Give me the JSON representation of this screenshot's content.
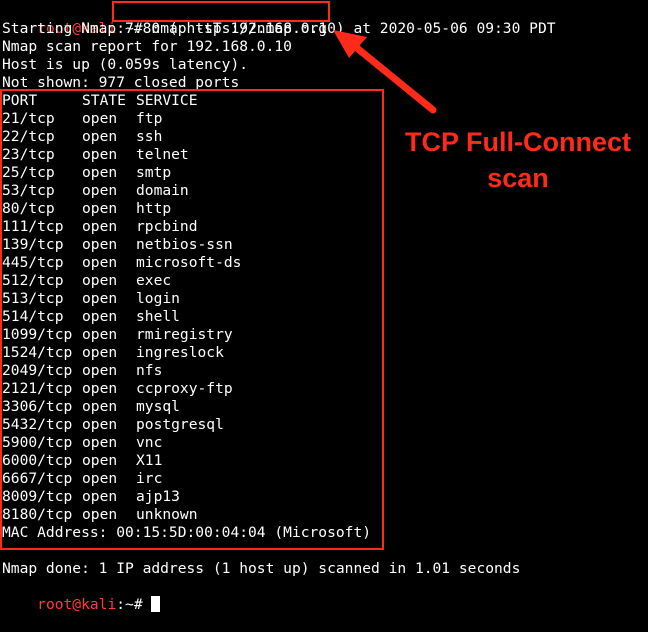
{
  "prompt": {
    "user_host": "root@kali",
    "separator": ":",
    "path": "~",
    "symbol": "#"
  },
  "command": "nmap -sT 192.168.0.10",
  "output": {
    "starting": "Starting Nmap 7.80 ( https://nmap.org ) at 2020-05-06 09:30 PDT",
    "scan_report": "Nmap scan report for 192.168.0.10",
    "host_up": "Host is up (0.059s latency).",
    "not_shown": "Not shown: 977 closed ports",
    "header": {
      "port": "PORT",
      "state": "STATE",
      "service": "SERVICE"
    },
    "ports": [
      {
        "port": "21/tcp",
        "state": "open",
        "service": "ftp"
      },
      {
        "port": "22/tcp",
        "state": "open",
        "service": "ssh"
      },
      {
        "port": "23/tcp",
        "state": "open",
        "service": "telnet"
      },
      {
        "port": "25/tcp",
        "state": "open",
        "service": "smtp"
      },
      {
        "port": "53/tcp",
        "state": "open",
        "service": "domain"
      },
      {
        "port": "80/tcp",
        "state": "open",
        "service": "http"
      },
      {
        "port": "111/tcp",
        "state": "open",
        "service": "rpcbind"
      },
      {
        "port": "139/tcp",
        "state": "open",
        "service": "netbios-ssn"
      },
      {
        "port": "445/tcp",
        "state": "open",
        "service": "microsoft-ds"
      },
      {
        "port": "512/tcp",
        "state": "open",
        "service": "exec"
      },
      {
        "port": "513/tcp",
        "state": "open",
        "service": "login"
      },
      {
        "port": "514/tcp",
        "state": "open",
        "service": "shell"
      },
      {
        "port": "1099/tcp",
        "state": "open",
        "service": "rmiregistry"
      },
      {
        "port": "1524/tcp",
        "state": "open",
        "service": "ingreslock"
      },
      {
        "port": "2049/tcp",
        "state": "open",
        "service": "nfs"
      },
      {
        "port": "2121/tcp",
        "state": "open",
        "service": "ccproxy-ftp"
      },
      {
        "port": "3306/tcp",
        "state": "open",
        "service": "mysql"
      },
      {
        "port": "5432/tcp",
        "state": "open",
        "service": "postgresql"
      },
      {
        "port": "5900/tcp",
        "state": "open",
        "service": "vnc"
      },
      {
        "port": "6000/tcp",
        "state": "open",
        "service": "X11"
      },
      {
        "port": "6667/tcp",
        "state": "open",
        "service": "irc"
      },
      {
        "port": "8009/tcp",
        "state": "open",
        "service": "ajp13"
      },
      {
        "port": "8180/tcp",
        "state": "open",
        "service": "unknown"
      }
    ],
    "mac": "MAC Address: 00:15:5D:00:04:04 (Microsoft)",
    "done": "Nmap done: 1 IP address (1 host up) scanned in 1.01 seconds"
  },
  "annotation": {
    "line1": "TCP Full-Connect",
    "line2": "scan"
  },
  "colors": {
    "background": "#000000",
    "text": "#ffffff",
    "prompt_user": "#ff3c3c",
    "annotation": "#ff2a1a"
  }
}
